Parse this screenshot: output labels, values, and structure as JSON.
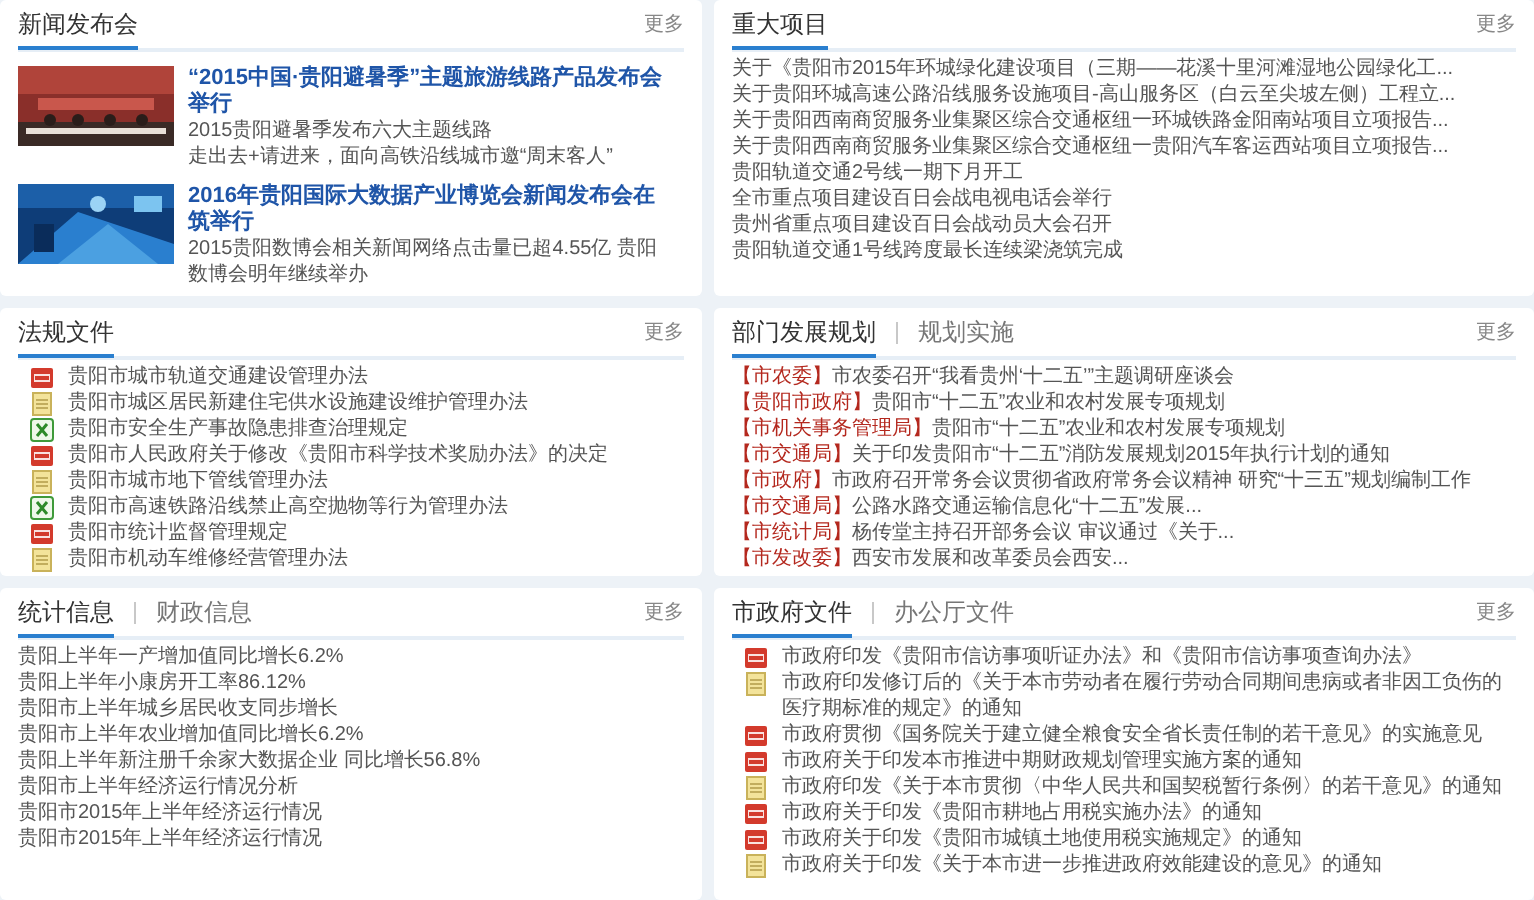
{
  "panels": [
    {
      "kind": "news",
      "tabs": [
        {
          "label": "新闻发布会",
          "selected": true
        }
      ],
      "more": "更多",
      "items": [
        {
          "title": "“2015中国·贵阳避暑季”主题旅游线路产品发布会举行",
          "lines": [
            "2015贵阳避暑季发布六大主题线路",
            "走出去+请进来，面向高铁沿线城市邀“周末客人”"
          ]
        },
        {
          "title": "2016年贵阳国际大数据产业博览会新闻发布会在筑举行",
          "lines": [
            "2015贵阳数博会相关新闻网络点击量已超4.55亿 贵阳数博会明年继续举办"
          ]
        }
      ]
    },
    {
      "kind": "list",
      "tabs": [
        {
          "label": "重大项目",
          "selected": true
        }
      ],
      "more": "更多",
      "items": [
        {
          "text": "关于《贵阳市2015年环城绿化建设项目（三期——花溪十里河滩湿地公园绿化工..."
        },
        {
          "text": "关于贵阳环城高速公路沿线服务设施项目-高山服务区（白云至尖坡左侧）工程立..."
        },
        {
          "text": "关于贵阳西南商贸服务业集聚区综合交通枢纽一环城铁路金阳南站项目立项报告..."
        },
        {
          "text": "关于贵阳西南商贸服务业集聚区综合交通枢纽一贵阳汽车客运西站项目立项报告..."
        },
        {
          "text": "贵阳轨道交通2号线一期下月开工"
        },
        {
          "text": "全市重点项目建设百日会战电视电话会举行"
        },
        {
          "text": "贵州省重点项目建设百日会战动员大会召开"
        },
        {
          "text": "贵阳轨道交通1号线跨度最长连续梁浇筑完成"
        }
      ]
    },
    {
      "kind": "files",
      "tabs": [
        {
          "label": "法规文件",
          "selected": true
        }
      ],
      "more": "更多",
      "items": [
        {
          "kind": "pdf",
          "text": "贵阳市城市轨道交通建设管理办法"
        },
        {
          "kind": "doc",
          "text": "贵阳市城区居民新建住宅供水设施建设维护管理办法"
        },
        {
          "kind": "xls",
          "text": "贵阳市安全生产事故隐患排查治理规定"
        },
        {
          "kind": "pdf",
          "text": "贵阳市人民政府关于修改《贵阳市科学技术奖励办法》的决定"
        },
        {
          "kind": "doc",
          "text": "贵阳市城市地下管线管理办法"
        },
        {
          "kind": "xls",
          "text": "贵阳市高速铁路沿线禁止高空抛物等行为管理办法"
        },
        {
          "kind": "pdf",
          "text": "贵阳市统计监督管理规定"
        },
        {
          "kind": "doc",
          "text": "贵阳市机动车维修经营管理办法"
        }
      ]
    },
    {
      "kind": "tagged",
      "tabs": [
        {
          "label": "部门发展规划",
          "selected": true
        },
        {
          "label": "规划实施",
          "selected": false
        }
      ],
      "more": "更多",
      "items": [
        {
          "tag": "【市农委】",
          "text": "市农委召开“我看贵州‘十二五’”主题调研座谈会"
        },
        {
          "tag": "【贵阳市政府】",
          "text": "贵阳市“十二五”农业和农村发展专项规划"
        },
        {
          "tag": "【市机关事务管理局】",
          "text": "贵阳市“十二五”农业和农村发展专项规划"
        },
        {
          "tag": "【市交通局】",
          "text": "关于印发贵阳市“十二五”消防发展规划2015年执行计划的通知"
        },
        {
          "tag": "【市政府】",
          "text": "市政府召开常务会议贯彻省政府常务会议精神 研究“十三五”规划编制工作"
        },
        {
          "tag": "【市交通局】",
          "text": "公路水路交通运输信息化“十二五”发展..."
        },
        {
          "tag": "【市统计局】",
          "text": "杨传堂主持召开部务会议 审议通过《关于..."
        },
        {
          "tag": "【市发改委】",
          "text": "西安市发展和改革委员会西安..."
        }
      ]
    },
    {
      "kind": "list",
      "tabs": [
        {
          "label": "统计信息",
          "selected": true
        },
        {
          "label": "财政信息",
          "selected": false
        }
      ],
      "more": "更多",
      "items": [
        {
          "text": "贵阳上半年一产增加值同比增长6.2%"
        },
        {
          "text": "贵阳上半年小康房开工率86.12%"
        },
        {
          "text": "贵阳市上半年城乡居民收支同步增长"
        },
        {
          "text": "贵阳市上半年农业增加值同比增长6.2%"
        },
        {
          "text": "贵阳上半年新注册千余家大数据企业 同比增长56.8%"
        },
        {
          "text": "贵阳市上半年经济运行情况分析"
        },
        {
          "text": "贵阳市2015年上半年经济运行情况"
        },
        {
          "text": "贵阳市2015年上半年经济运行情况"
        }
      ]
    },
    {
      "kind": "files",
      "tabs": [
        {
          "label": "市政府文件",
          "selected": true
        },
        {
          "label": "办公厅文件",
          "selected": false
        }
      ],
      "more": "更多",
      "items": [
        {
          "kind": "pdf",
          "text": "市政府印发《贵阳市信访事项听证办法》和《贵阳市信访事项查询办法》"
        },
        {
          "kind": "doc",
          "text": "市政府印发修订后的《关于本市劳动者在履行劳动合同期间患病或者非因工负伤的医疗期标准的规定》的通知"
        },
        {
          "kind": "pdf",
          "text": "市政府贯彻《国务院关于建立健全粮食安全省长责任制的若干意见》的实施意见"
        },
        {
          "kind": "pdf",
          "text": "市政府关于印发本市推进中期财政规划管理实施方案的通知"
        },
        {
          "kind": "doc",
          "text": "市政府印发《关于本市贯彻〈中华人民共和国契税暂行条例〉的若干意见》的通知"
        },
        {
          "kind": "pdf",
          "text": "市政府关于印发《贵阳市耕地占用税实施办法》的通知"
        },
        {
          "kind": "pdf",
          "text": "市政府关于印发《贵阳市城镇土地使用税实施规定》的通知"
        },
        {
          "kind": "doc",
          "text": "市政府关于印发《关于本市进一步推进政府效能建设的意见》的通知"
        }
      ]
    }
  ]
}
